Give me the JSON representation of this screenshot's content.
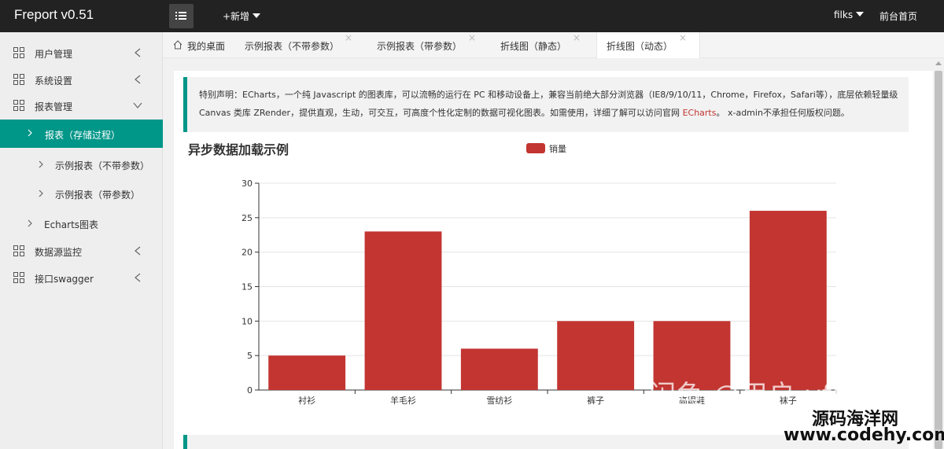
{
  "app": {
    "title": "Freport v0.51"
  },
  "topbar": {
    "add_new": "+新增",
    "user": "filks",
    "front_page": "前台首页"
  },
  "sidebar": {
    "items": [
      {
        "label": "用户管理"
      },
      {
        "label": "系统设置"
      },
      {
        "label": "报表管理"
      },
      {
        "label": "报表（存储过程）"
      },
      {
        "label": "示例报表（不带参数）"
      },
      {
        "label": "示例报表（带参数）"
      },
      {
        "label": "Echarts图表"
      },
      {
        "label": "数据源监控"
      },
      {
        "label": "接口swagger"
      }
    ]
  },
  "tabs": [
    {
      "label": "我的桌面"
    },
    {
      "label": "示例报表（不带参数）",
      "close": "×"
    },
    {
      "label": "示例报表（带参数）",
      "close": "×"
    },
    {
      "label": "折线图（静态）",
      "close": "×"
    },
    {
      "label": "折线图（动态）",
      "close": "×"
    }
  ],
  "notice": {
    "line1": "特别声明：ECharts，一个纯 Javascript 的图表库，可以流畅的运行在 PC 和移动设备上，兼容当前绝大部分浏览器（IE8/9/10/11，Chrome，Firefox，Safari等），底层依赖轻量级",
    "line2_a": "Canvas 类库 ZRender，提供直观，生动，可交互，可高度个性化定制的数据可视化图表。如需使用，详细了解可以访问官网 ",
    "link": "ECharts",
    "line2_b": "。 x-admin不承担任何版权问题。"
  },
  "chart_data": {
    "type": "bar",
    "title": "异步数据加载示例",
    "legend": [
      "销量"
    ],
    "legend_position": "top-center",
    "categories": [
      "衬衫",
      "羊毛衫",
      "雪纺衫",
      "裤子",
      "高跟鞋",
      "袜子"
    ],
    "series": [
      {
        "name": "销量",
        "values": [
          5,
          23,
          6,
          10,
          10,
          26
        ],
        "color": "#c23531"
      }
    ],
    "ylim": [
      0,
      30
    ],
    "yticks": [
      "0",
      "5",
      "10",
      "15",
      "20",
      "25",
      "30"
    ],
    "grid": true
  },
  "watermarks": {
    "overlay": "闲鱼 @用户 vfilks",
    "site_name": "源码海洋网",
    "site_url": "www.codehy.com"
  },
  "colors": {
    "accent": "#009688",
    "bar": "#c23531",
    "topbar": "#222222"
  }
}
